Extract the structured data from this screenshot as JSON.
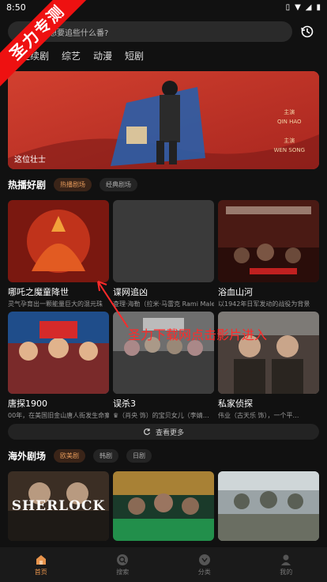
{
  "status": {
    "time": "8:50"
  },
  "ribbon": {
    "text": "圣力专测"
  },
  "search": {
    "placeholder": "想要追些什么番?"
  },
  "category_tabs": [
    "连续剧",
    "综艺",
    "动漫",
    "短剧"
  ],
  "banner": {
    "title": "这位壮士",
    "credits": [
      "主演",
      "QIN HAO",
      "",
      "主演",
      "WEN SONG"
    ]
  },
  "hot": {
    "title": "热播好剧",
    "chips": [
      "热播剧场",
      "经典剧场"
    ],
    "active_chip": 0,
    "items": [
      {
        "title": "哪吒之魔童降世",
        "desc": "灵气孕育出一颗能量巨大的混元珠"
      },
      {
        "title": "谍网追凶",
        "desc": "查理·海勒（拉米·马雷克 Rami Malek）"
      },
      {
        "title": "浴血山河",
        "desc": "以1942年日军发动的战役为背景"
      },
      {
        "title": "唐探1900",
        "desc": "00年，在美国旧金山唐人街发生命案"
      },
      {
        "title": "误杀3",
        "desc": "♛（肖央 饰）的宝贝女儿（李婧…"
      },
      {
        "title": "私家侦探",
        "desc": "伟业（古天乐 饰），一个平…"
      }
    ],
    "see_more": "查看更多"
  },
  "overseas": {
    "title": "海外剧场",
    "chips": [
      "欧美剧",
      "韩剧",
      "日剧"
    ],
    "active_chip": 0,
    "poster_labels": [
      "SHERLOCK",
      "",
      ""
    ]
  },
  "overlay": {
    "text": "圣力下载网点击影片进入"
  },
  "bottom_nav": [
    {
      "label": "首页",
      "icon": "home-icon"
    },
    {
      "label": "搜索",
      "icon": "search-icon"
    },
    {
      "label": "分类",
      "icon": "category-icon"
    },
    {
      "label": "我的",
      "icon": "profile-icon"
    }
  ],
  "colors": {
    "accent": "#e8944c",
    "watermark": "#e11111"
  }
}
